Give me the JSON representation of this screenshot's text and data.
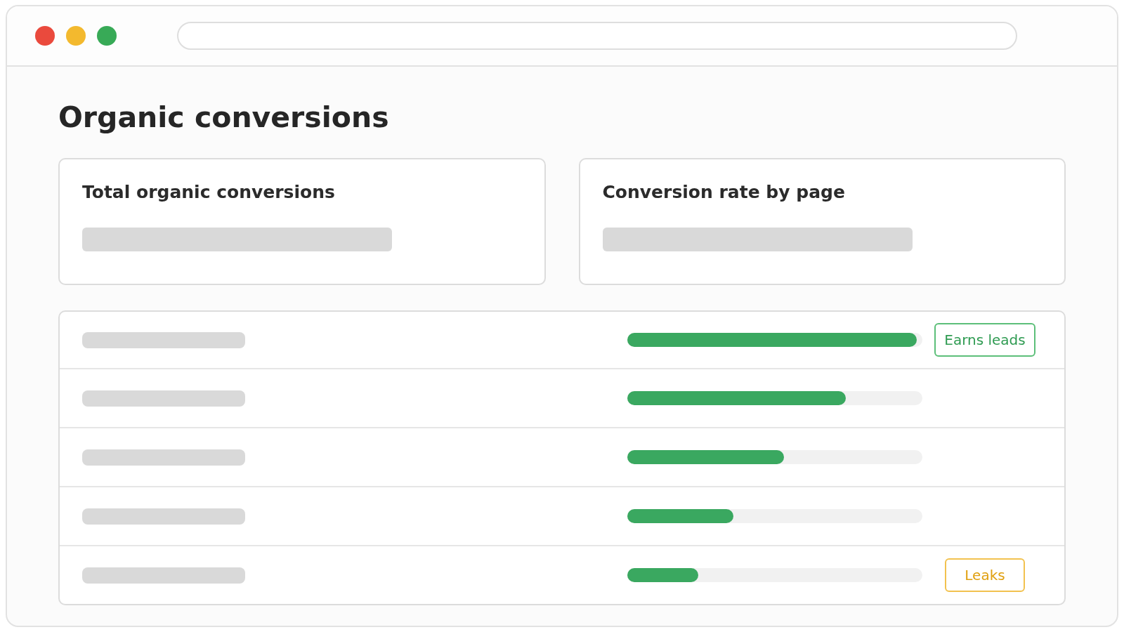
{
  "window": {
    "title": "Organic conversions"
  },
  "cards": [
    {
      "title": "Total organic conversions"
    },
    {
      "title": "Conversion rate by page"
    }
  ],
  "rows": [
    {
      "level": 0.98,
      "badge": {
        "label": "Earns leads",
        "kind": "positive"
      }
    },
    {
      "level": 0.74
    },
    {
      "level": 0.53
    },
    {
      "level": 0.36
    },
    {
      "level": 0.24,
      "badge": {
        "label": "Leaks",
        "kind": "warning"
      }
    }
  ]
}
